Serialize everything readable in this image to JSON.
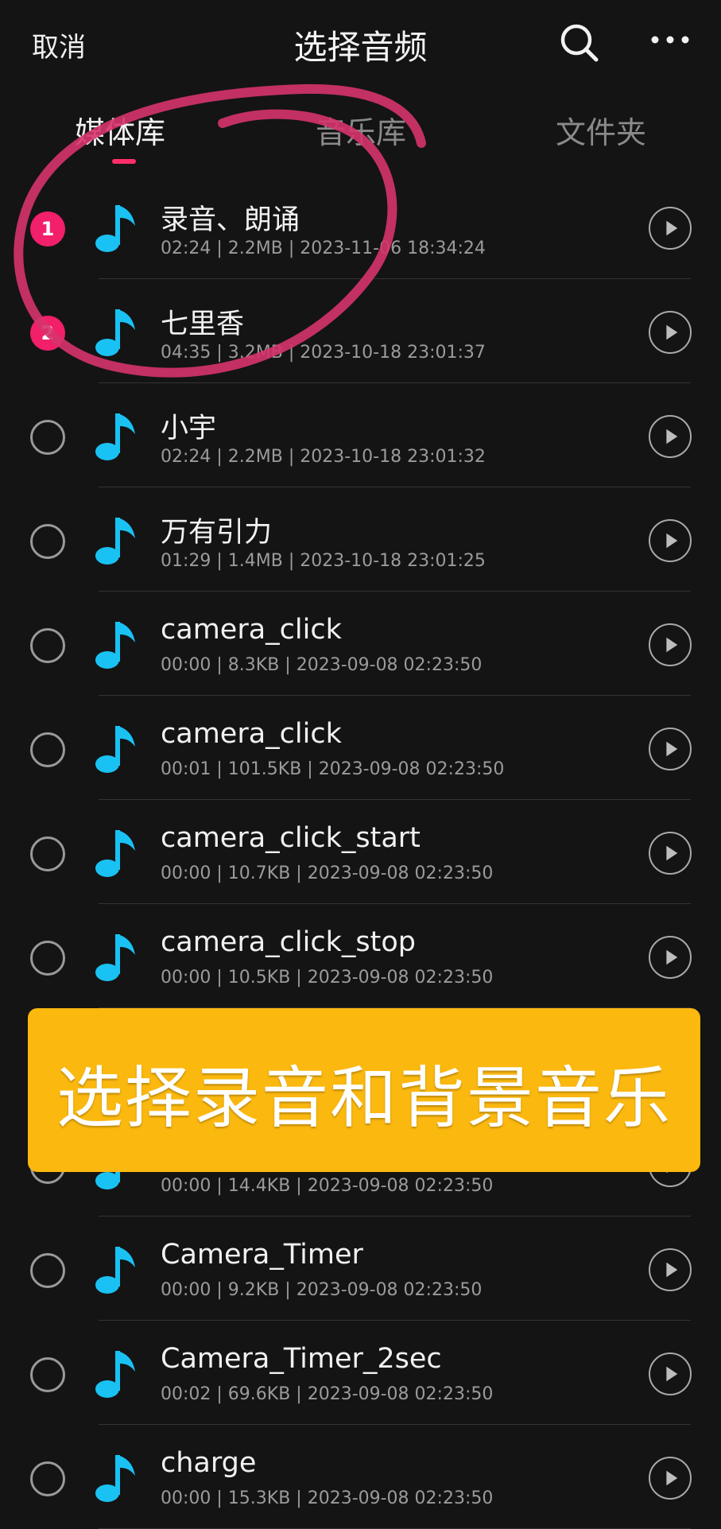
{
  "header": {
    "cancel_label": "取消",
    "title": "选择音频",
    "search_icon": "search-icon",
    "more_icon": "more-icon"
  },
  "tabs": [
    {
      "label": "媒体库",
      "active": true
    },
    {
      "label": "音乐库",
      "active": false
    },
    {
      "label": "文件夹",
      "active": false
    }
  ],
  "accent_color": "#f21f6a",
  "note_color": "#19c2f2",
  "items": [
    {
      "name": "录音、朗诵",
      "meta": "02:24 | 2.2MB | 2023-11-06 18:34:24",
      "selected_index": "1"
    },
    {
      "name": "七里香",
      "meta": "04:35 | 3.2MB | 2023-10-18 23:01:37",
      "selected_index": "2"
    },
    {
      "name": "小宇",
      "meta": "02:24 | 2.2MB | 2023-10-18 23:01:32",
      "selected_index": ""
    },
    {
      "name": "万有引力",
      "meta": "01:29 | 1.4MB | 2023-10-18 23:01:25",
      "selected_index": ""
    },
    {
      "name": "camera_click",
      "meta": "00:00 | 8.3KB | 2023-09-08 02:23:50",
      "selected_index": ""
    },
    {
      "name": "camera_click",
      "meta": "00:01 | 101.5KB | 2023-09-08 02:23:50",
      "selected_index": ""
    },
    {
      "name": "camera_click_start",
      "meta": "00:00 | 10.7KB | 2023-09-08 02:23:50",
      "selected_index": ""
    },
    {
      "name": "camera_click_stop",
      "meta": "00:00 | 10.5KB | 2023-09-08 02:23:50",
      "selected_index": ""
    },
    {
      "name": "",
      "meta": "",
      "selected_index": ""
    },
    {
      "name": "",
      "meta": "00:00 | 14.4KB | 2023-09-08 02:23:50",
      "selected_index": ""
    },
    {
      "name": "Camera_Timer",
      "meta": "00:00 | 9.2KB | 2023-09-08 02:23:50",
      "selected_index": ""
    },
    {
      "name": "Camera_Timer_2sec",
      "meta": "00:02 | 69.6KB | 2023-09-08 02:23:50",
      "selected_index": ""
    },
    {
      "name": "charge",
      "meta": "00:00 | 15.3KB | 2023-09-08 02:23:50",
      "selected_index": ""
    }
  ],
  "banner": {
    "text": "选择录音和背景音乐",
    "color": "#fbb80f"
  }
}
